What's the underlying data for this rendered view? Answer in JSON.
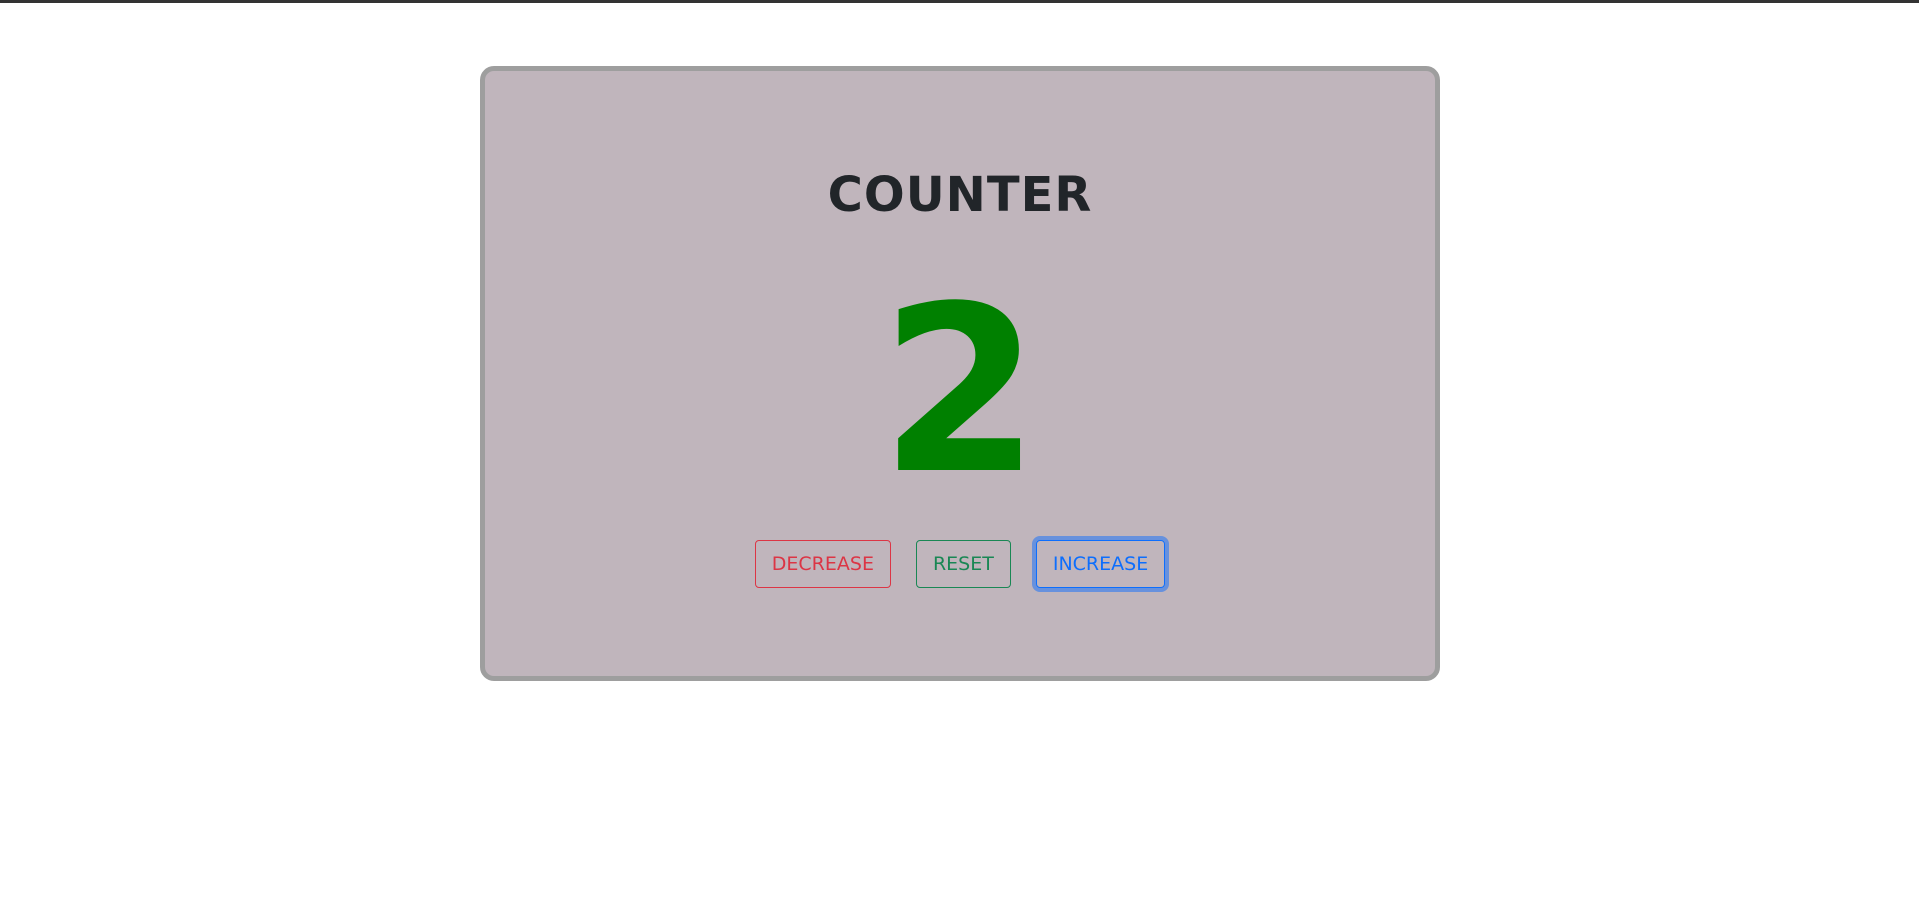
{
  "counter": {
    "title": "COUNTER",
    "value": "2",
    "value_color": "#008000"
  },
  "buttons": {
    "decrease_label": "DECREASE",
    "reset_label": "RESET",
    "increase_label": "INCREASE"
  },
  "colors": {
    "card_background": "#c0b5bc",
    "card_border": "#9e9e9e",
    "decrease": "#dc3545",
    "reset": "#198754",
    "increase": "#0d6efd"
  },
  "focused_button": "increase"
}
